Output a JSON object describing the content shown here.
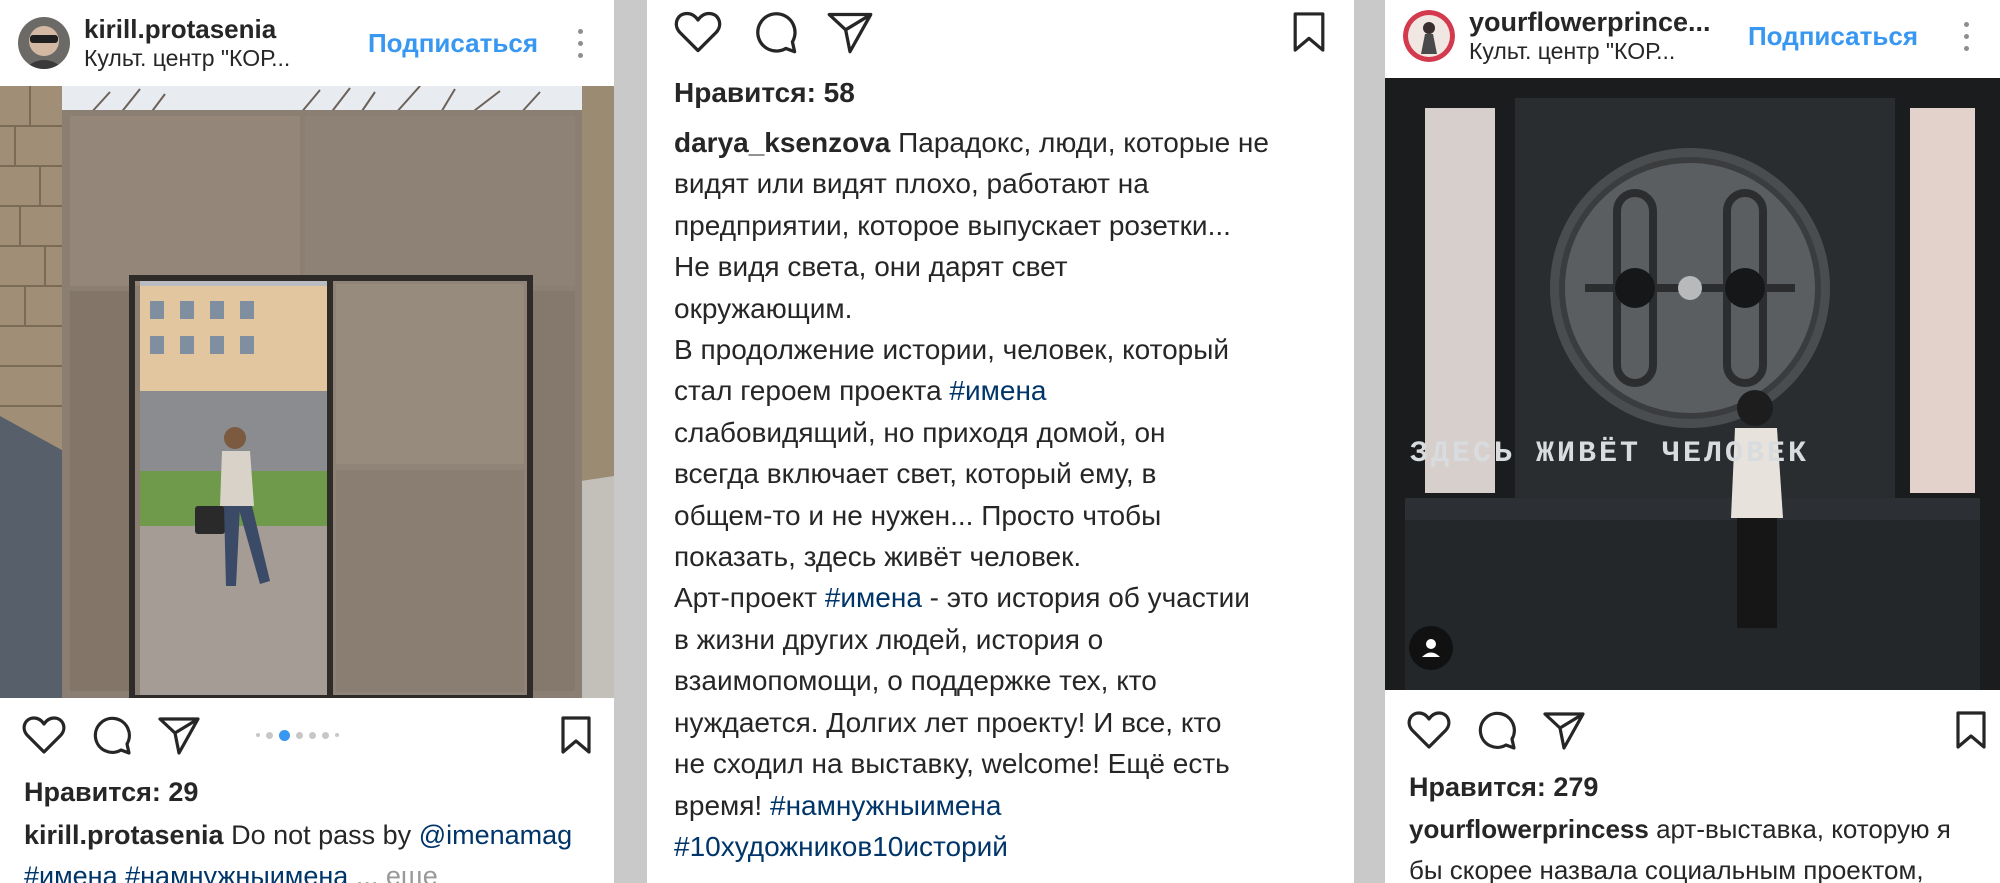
{
  "post1": {
    "username": "kirill.protasenia",
    "location": "Культ. центр \"КОР...",
    "follow_label": "Подписаться",
    "likes": "Нравится: 29",
    "caption": {
      "user": "kirill.protasenia",
      "text": " Do not pass by ",
      "mention": "@imenamag",
      "tag1": "#имена",
      "tag2": "#намнужныимена",
      "ellipsis": " ... ",
      "more": "еще"
    },
    "carousel": {
      "count": 7,
      "active_index": 2
    }
  },
  "post2": {
    "likes": "Нравится: 58",
    "caption": {
      "user": "darya_ksenzova",
      "l1": " Парадокс, люди, которые не",
      "l2": "видят или видят плохо, работают на",
      "l3": "предприятии, которое выпускает розетки...",
      "l4": "Не видя света, они дарят свет",
      "l5": "окружающим.",
      "l6": "В продолжение истории, человек, который",
      "l7": "стал героем проекта ",
      "l7_tag": "#имена",
      "l8": "слабовидящий, но приходя домой, он",
      "l9": "всегда включает свет, который ему, в",
      "l10": "общем-то и не нужен... Просто чтобы",
      "l11": "показать, здесь живёт человек.",
      "l12_pre": "Арт-проект ",
      "l12_tag": "#имена",
      "l12_post": " - это история об участии",
      "l13": "в жизни других людей, история о",
      "l14": "взаимопомощи, о поддержке тех, кто",
      "l15": "нуждается. Долгих лет проекту! И все, кто",
      "l16": "не сходил на выставку, welcome! Ещё есть",
      "l17_pre": "время! ",
      "l17_tag": "#намнужныимена",
      "l18_tag": "#10художников10историй"
    }
  },
  "post3": {
    "username": "yourflowerprince...",
    "location": "Культ. центр \"КОР...",
    "follow_label": "Подписаться",
    "photo_sign": "ЗДЕСЬ ЖИВЁТ ЧЕЛОВЕК",
    "likes": "Нравится: 279",
    "caption": {
      "user": "yourflowerprincess",
      "l1": " арт-выставка, которую я",
      "l2": "бы скорее назвала социальным проектом,"
    }
  },
  "icons": [
    "heart-icon",
    "comment-icon",
    "share-icon",
    "bookmark-icon",
    "more-icon",
    "user-tag-icon"
  ],
  "colors": {
    "link": "#3897f0",
    "hashtag": "#003569",
    "text": "#262626",
    "muted": "#999999",
    "background": "#c9c9c9"
  }
}
